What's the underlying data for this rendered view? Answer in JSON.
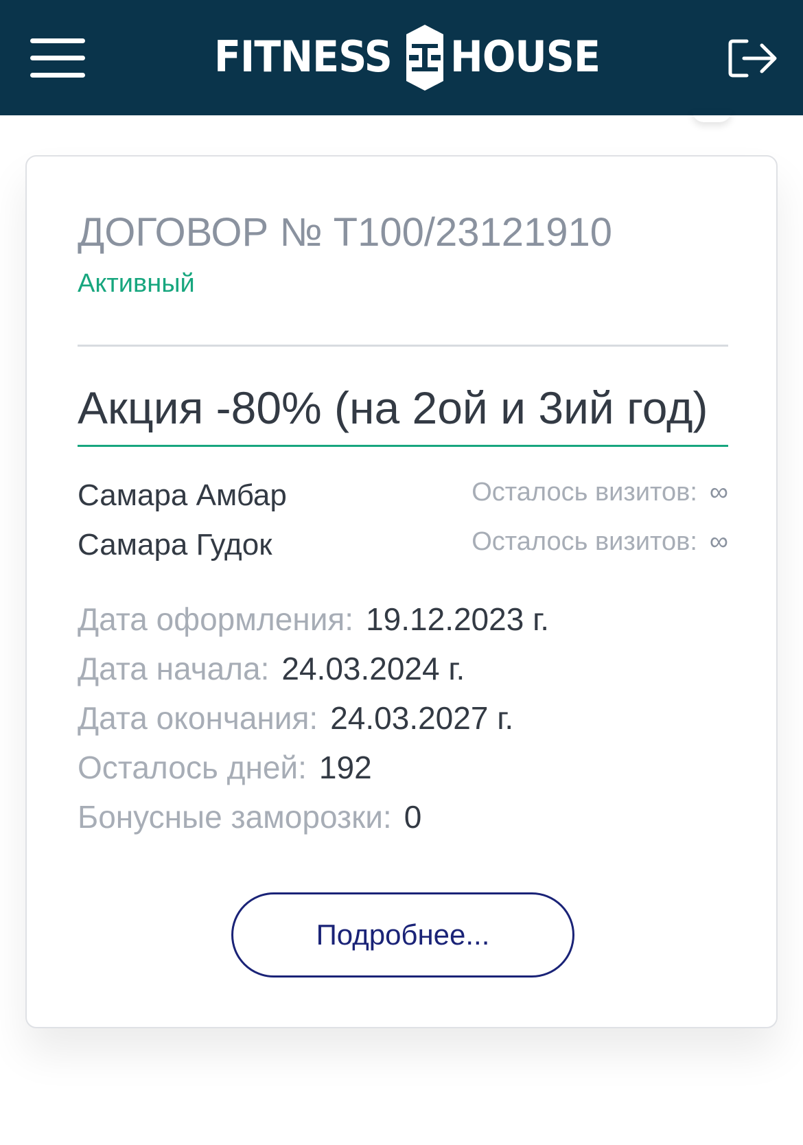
{
  "header": {
    "logo_left": "FITNESS",
    "logo_right": "HOUSE",
    "bg_color": "#0a344b"
  },
  "card": {
    "contract_title": "ДОГОВОР № Т100/23121910",
    "status": "Активный",
    "offer_name": "Акция -80% (на 2ой и 3ий год)",
    "clubs": [
      {
        "name": "Самара Амбар",
        "visits_label": "Осталось визитов:",
        "visits_value": "∞"
      },
      {
        "name": "Самара Гудок",
        "visits_label": "Осталось визитов:",
        "visits_value": "∞"
      }
    ],
    "info": {
      "issue_date_label": "Дата оформления:",
      "issue_date_value": "19.12.2023 г.",
      "start_date_label": "Дата начала:",
      "start_date_value": "24.03.2024 г.",
      "end_date_label": "Дата окончания:",
      "end_date_value": "24.03.2027 г.",
      "days_left_label": "Осталось дней:",
      "days_left_value": "192",
      "bonus_freezes_label": "Бонусные заморозки:",
      "bonus_freezes_value": "0"
    },
    "details_button": "Подробнее..."
  },
  "colors": {
    "accent_green": "#17a67e",
    "button_navy": "#1a2377",
    "muted_text": "#a7adb6",
    "dark_text": "#333a44"
  },
  "icons": {
    "menu": "hamburger-menu-icon",
    "logout": "logout-icon",
    "logo": "dumbbell-logo-icon"
  }
}
